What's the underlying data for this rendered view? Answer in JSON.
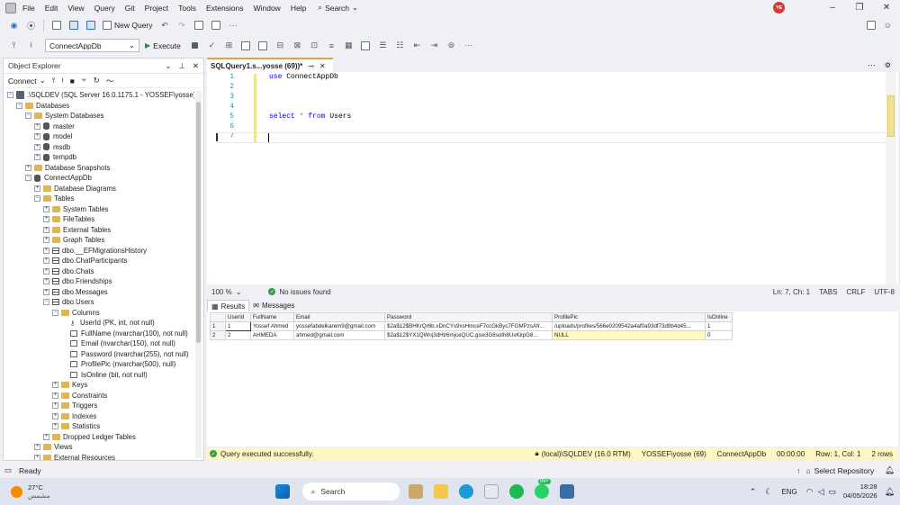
{
  "menu": {
    "items": [
      "File",
      "Edit",
      "View",
      "Query",
      "Git",
      "Project",
      "Tools",
      "Extensions",
      "Window",
      "Help"
    ],
    "search": "Search",
    "avatar": "YE"
  },
  "toolbar": {
    "new_query": "New Query",
    "database": "ConnectAppDb",
    "execute": "Execute"
  },
  "object_explorer": {
    "title": "Object Explorer",
    "connect": "Connect",
    "tree": [
      {
        "indent": 0,
        "exp": "−",
        "icon": "server",
        "label": ".\\SQLDEV (SQL Server 16.0.1175.1 - YOSSEF\\yosse)"
      },
      {
        "indent": 1,
        "exp": "−",
        "icon": "folder",
        "label": "Databases"
      },
      {
        "indent": 2,
        "exp": "−",
        "icon": "folder",
        "label": "System Databases"
      },
      {
        "indent": 3,
        "exp": "+",
        "icon": "db",
        "label": "master"
      },
      {
        "indent": 3,
        "exp": "+",
        "icon": "db",
        "label": "model"
      },
      {
        "indent": 3,
        "exp": "+",
        "icon": "db",
        "label": "msdb"
      },
      {
        "indent": 3,
        "exp": "+",
        "icon": "db",
        "label": "tempdb"
      },
      {
        "indent": 2,
        "exp": "+",
        "icon": "folder",
        "label": "Database Snapshots"
      },
      {
        "indent": 2,
        "exp": "−",
        "icon": "db",
        "label": "ConnectAppDb"
      },
      {
        "indent": 3,
        "exp": "+",
        "icon": "folder",
        "label": "Database Diagrams"
      },
      {
        "indent": 3,
        "exp": "−",
        "icon": "folder",
        "label": "Tables"
      },
      {
        "indent": 4,
        "exp": "+",
        "icon": "folder",
        "label": "System Tables"
      },
      {
        "indent": 4,
        "exp": "+",
        "icon": "folder",
        "label": "FileTables"
      },
      {
        "indent": 4,
        "exp": "+",
        "icon": "folder",
        "label": "External Tables"
      },
      {
        "indent": 4,
        "exp": "+",
        "icon": "folder",
        "label": "Graph Tables"
      },
      {
        "indent": 4,
        "exp": "+",
        "icon": "table",
        "label": "dbo.__EFMigrationsHistory"
      },
      {
        "indent": 4,
        "exp": "+",
        "icon": "table",
        "label": "dbo.ChatParticipants"
      },
      {
        "indent": 4,
        "exp": "+",
        "icon": "table",
        "label": "dbo.Chats"
      },
      {
        "indent": 4,
        "exp": "+",
        "icon": "table",
        "label": "dbo.Friendships"
      },
      {
        "indent": 4,
        "exp": "+",
        "icon": "table",
        "label": "dbo.Messages"
      },
      {
        "indent": 4,
        "exp": "−",
        "icon": "table",
        "label": "dbo.Users"
      },
      {
        "indent": 5,
        "exp": "−",
        "icon": "folder",
        "label": "Columns"
      },
      {
        "indent": 6,
        "exp": "",
        "icon": "key",
        "label": "UserId (PK, int, not null)"
      },
      {
        "indent": 6,
        "exp": "",
        "icon": "col",
        "label": "FullName (nvarchar(100), not null)"
      },
      {
        "indent": 6,
        "exp": "",
        "icon": "col",
        "label": "Email (nvarchar(150), not null)"
      },
      {
        "indent": 6,
        "exp": "",
        "icon": "col",
        "label": "Password (nvarchar(255), not null)"
      },
      {
        "indent": 6,
        "exp": "",
        "icon": "col",
        "label": "ProfilePic (nvarchar(500), null)"
      },
      {
        "indent": 6,
        "exp": "",
        "icon": "col",
        "label": "IsOnline (bit, not null)"
      },
      {
        "indent": 5,
        "exp": "+",
        "icon": "folder",
        "label": "Keys"
      },
      {
        "indent": 5,
        "exp": "+",
        "icon": "folder",
        "label": "Constraints"
      },
      {
        "indent": 5,
        "exp": "+",
        "icon": "folder",
        "label": "Triggers"
      },
      {
        "indent": 5,
        "exp": "+",
        "icon": "folder",
        "label": "Indexes"
      },
      {
        "indent": 5,
        "exp": "+",
        "icon": "folder",
        "label": "Statistics"
      },
      {
        "indent": 4,
        "exp": "+",
        "icon": "folder",
        "label": "Dropped Ledger Tables"
      },
      {
        "indent": 3,
        "exp": "+",
        "icon": "folder",
        "label": "Views"
      },
      {
        "indent": 3,
        "exp": "+",
        "icon": "folder",
        "label": "External Resources"
      }
    ]
  },
  "editor": {
    "tab_title": "SQLQuery1.s...yosse (69))*",
    "lines": [
      {
        "n": "1",
        "parts": [
          {
            "t": "use ",
            "c": "kw"
          },
          {
            "t": "ConnectAppDb",
            "c": ""
          }
        ]
      },
      {
        "n": "2",
        "parts": []
      },
      {
        "n": "3",
        "parts": []
      },
      {
        "n": "4",
        "parts": []
      },
      {
        "n": "5",
        "parts": [
          {
            "t": "select ",
            "c": "kw"
          },
          {
            "t": "* ",
            "c": "gray"
          },
          {
            "t": "from ",
            "c": "kw"
          },
          {
            "t": "Users",
            "c": ""
          }
        ]
      },
      {
        "n": "6",
        "parts": []
      },
      {
        "n": "7",
        "parts": []
      }
    ],
    "zoom": "100 %",
    "issues": "No issues found",
    "cursor": "Ln: 7, Ch: 1",
    "tabs": "TABS",
    "eol": "CRLF",
    "encoding": "UTF-8"
  },
  "results": {
    "tab_results": "Results",
    "tab_messages": "Messages",
    "columns": [
      "UserId",
      "FullName",
      "Email",
      "Password",
      "ProfilePic",
      "IsOnline"
    ],
    "rows": [
      [
        "1",
        "1",
        "Yossef Ahmed",
        "yossefabdelkarem9@gmail.com",
        "$2a$12$BHKrQr6b.xDnCYs9xsHmceF7ccGkByc7FGMPzsAfr...",
        "/uploads/profiles/566e0209542a4af0a93df73d9b4d45...",
        "1"
      ],
      [
        "2",
        "2",
        "AHMEDA",
        "ahmed@gmail.com",
        "$2a$12$YX1QWnj3dHt/6mjceQUC.gsw3G8soth8UvKkpG8...",
        "NULL",
        "0"
      ]
    ]
  },
  "query_status": {
    "message": "Query executed successfully.",
    "server": "(local)\\SQLDEV (16.0 RTM)",
    "user": "YOSSEF\\yosse (69)",
    "database": "ConnectAppDb",
    "elapsed": "00:00:00",
    "position": "Row: 1, Col: 1",
    "row_count": "2 rows"
  },
  "app_status": {
    "ready": "Ready",
    "repo": "Select Repository"
  },
  "taskbar": {
    "temp": "27°C",
    "weather": "مشمس",
    "search": "Search",
    "badge": "99+",
    "lang": "ENG",
    "time": "18:28",
    "date": "04/05/2026"
  },
  "colors": {
    "accent": "#d4a84a",
    "keyword": "#0000ff",
    "status_bg": "#fff7c2"
  }
}
